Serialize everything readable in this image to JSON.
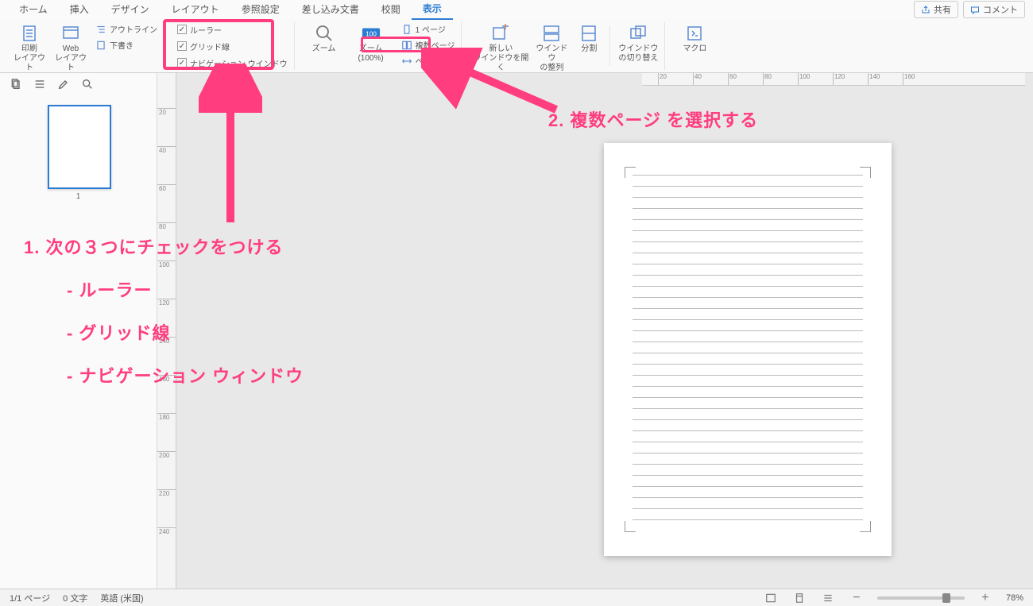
{
  "tabs": {
    "home": "ホーム",
    "insert": "挿入",
    "design": "デザイン",
    "layout": "レイアウト",
    "references": "参照設定",
    "mail": "差し込み文書",
    "review": "校閲",
    "view": "表示"
  },
  "top_right": {
    "share": "共有",
    "comments": "コメント"
  },
  "ribbon": {
    "view_group": {
      "print_layout": "印刷\nレイアウト",
      "web_layout": "Web\nレイアウト",
      "outline": "アウトライン",
      "draft": "下書き"
    },
    "show": {
      "ruler": "ルーラー",
      "grid": "グリッド線",
      "nav_pane": "ナビゲーション ウインドウ"
    },
    "zoom": {
      "zoom": "ズーム",
      "zoom_100": "ズーム (100%)",
      "one_page": "1 ページ",
      "multi_page": "複数ページ",
      "page_width": "ページの幅"
    },
    "window": {
      "new_window": "新しい\nウインドウを開く",
      "arrange": "ウインドウ\nの整列",
      "split": "分割",
      "switch": "ウインドウ\nの切り替え"
    },
    "macros": {
      "label": "マクロ"
    }
  },
  "nav": {
    "thumb_num": "1"
  },
  "ruler_v": [
    20,
    40,
    60,
    80,
    100,
    120,
    140,
    160,
    180,
    200,
    220,
    240
  ],
  "ruler_h": [
    20,
    40,
    60,
    80,
    100,
    120,
    140,
    160
  ],
  "status": {
    "page": "1/1 ページ",
    "words": "0 文字",
    "lang": "英語 (米国)",
    "zoom": "78%"
  },
  "annotations": {
    "a1_title": "1. 次の３つにチェックをつける",
    "a1_item1": "- ルーラー",
    "a1_item2": "- グリッド線",
    "a1_item3": "- ナビゲーション ウィンドウ",
    "a2": "2. 複数ページ を選択する"
  }
}
